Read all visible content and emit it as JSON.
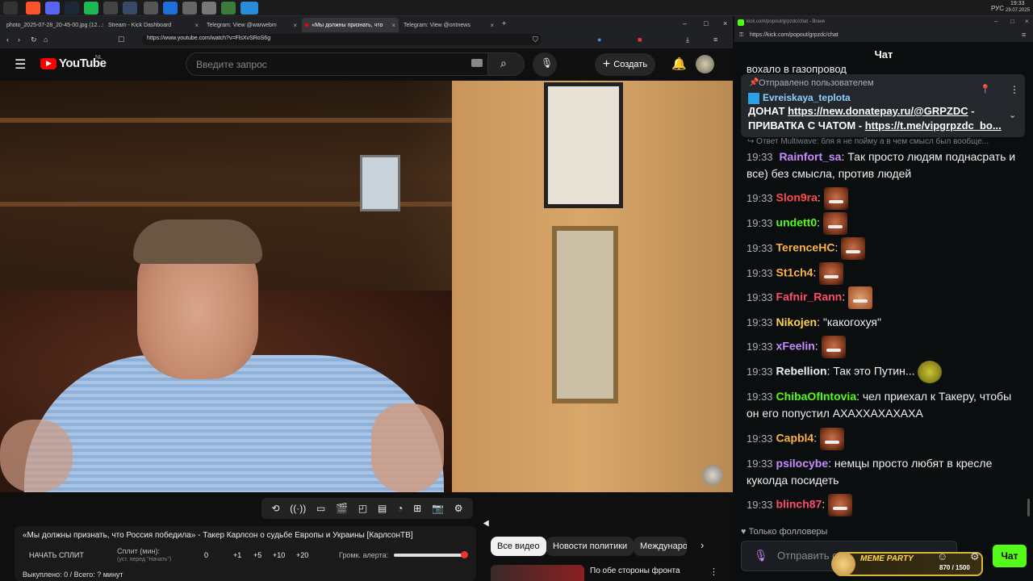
{
  "taskbar": {
    "time": "19:33",
    "date": "29.07.2025",
    "lang": "РУС"
  },
  "browser_left": {
    "tabs": [
      {
        "label": "photo_2025-07-28_20-45-00.jpg (12..."
      },
      {
        "label": "Stream - Kick Dashboard"
      },
      {
        "label": "Telegram: View @warwebm"
      },
      {
        "label": "«Мы должны признать, что"
      },
      {
        "label": "Telegram: View @ontnews"
      }
    ],
    "url": "https://www.youtube.com/watch?v=FlsXvSRoS6g"
  },
  "youtube": {
    "logo": "YouTube",
    "region": "NL",
    "search_placeholder": "Введите запрос",
    "create_label": "Создать"
  },
  "video_toolbar_icons": [
    "loop-icon",
    "broadcast-icon",
    "screen-watch-icon",
    "clapper-icon",
    "crop-icon",
    "film-icon",
    "speed-icon",
    "add-frame-icon",
    "camera-icon",
    "gear-icon"
  ],
  "info_panel": {
    "title": "«Мы должны признать, что Россия победила» - Такер Карлсон о судьбе Европы и Украины [КарлсонТВ]",
    "start_split": "НАЧАТЬ СПЛИТ",
    "split_label": "Сплит (мин):",
    "split_hint": "(уст. перед \"Начать\")",
    "split_value": "0",
    "increments": [
      "+1",
      "+5",
      "+10",
      "+20"
    ],
    "volume_label": "Громк. алерта:",
    "volume_level": 0.98,
    "bought": "Выкуплено: 0 / Всего: ? минут"
  },
  "chips": [
    {
      "label": "Все видео",
      "active": true
    },
    {
      "label": "Новости политики",
      "active": false
    },
    {
      "label": "Международ",
      "active": false
    }
  ],
  "rec_video_title": "По обе стороны фронта",
  "chat_browser": {
    "tab_title": "kick.com/popout/grpzdc/chat - Brave",
    "url": "https://kick.com/popout/grpzdc/chat"
  },
  "chat": {
    "title": "Чат",
    "clipped_text": "вохало в газопровод",
    "pinned": {
      "label": "Отправлено пользователем",
      "user": "Evreiskaya_teplota",
      "line1_text": "ДОНАТ ",
      "line1_link": "https://new.donatepay.ru/@GRPZDC",
      "line1_suffix": " -",
      "line2_text": "ПРИВАТКА С ЧАТОМ - ",
      "line2_link": "https://t.me/vipgrpzdc_bo..."
    },
    "reply_hint": "Ответ Multiwave: бля я не пойму а в чем смысл был вообще...",
    "messages": [
      {
        "time": "19:33",
        "user": "Rainfort_sa",
        "color": "#c78bff",
        "text": "Так просто людям поднасрать и все) без смысла, против людей"
      },
      {
        "time": "19:33",
        "user": "Slon9ra",
        "color": "#ff4b4b",
        "text": ""
      },
      {
        "time": "19:33",
        "user": "undett0",
        "color": "#53fc18",
        "text": ""
      },
      {
        "time": "19:33",
        "user": "TerenceHC",
        "color": "#ffb23f",
        "text": ""
      },
      {
        "time": "19:33",
        "user": "St1ch4",
        "color": "#ffb23f",
        "text": ""
      },
      {
        "time": "19:33",
        "user": "Fafnir_Rann",
        "color": "#ff4b6a",
        "text": ""
      },
      {
        "time": "19:33",
        "user": "Nikojen",
        "color": "#ffd24a",
        "text": "\"какогохуя\""
      },
      {
        "time": "19:33",
        "user": "xFeelin",
        "color": "#c78bff",
        "text": ""
      },
      {
        "time": "19:33",
        "user": "Rebellion",
        "color": "#efeff1",
        "text": "Так это Путин..."
      },
      {
        "time": "19:33",
        "user": "ChibaOfIntovia",
        "color": "#53fc18",
        "text": "чел приехал к Такеру, чтобы он его попустил АХАХХАХАХАХА"
      },
      {
        "time": "19:33",
        "user": "Capbl4",
        "color": "#ffb23f",
        "text": ""
      },
      {
        "time": "19:33",
        "user": "psilocybe",
        "color": "#c78bff",
        "text": "немцы просто любят в кресле куколда посидеть"
      },
      {
        "time": "19:33",
        "user": "blinch87",
        "color": "#ff4b6a",
        "text": ""
      }
    ],
    "followers_only": "Только фолловеры",
    "input_placeholder": "Отправить с",
    "send_label": "Чат",
    "meme_party": "MEME PARTY",
    "meme_progress": "870 / 1500"
  }
}
